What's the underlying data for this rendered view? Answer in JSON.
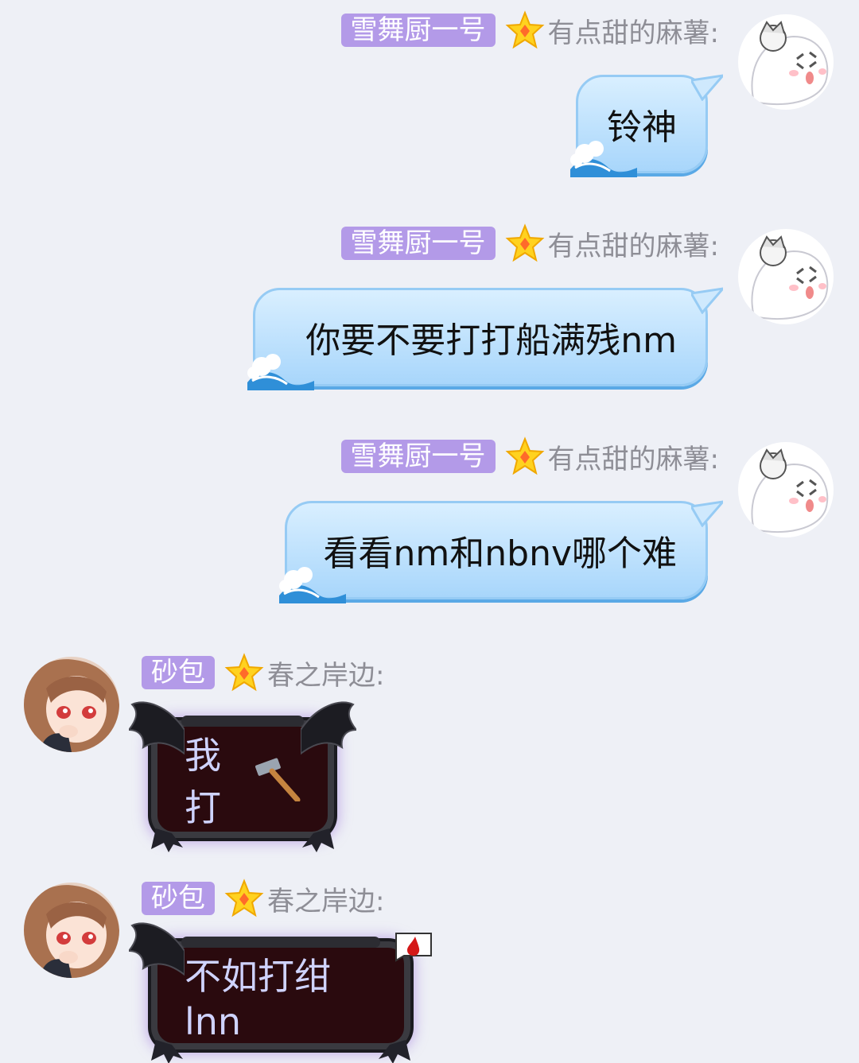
{
  "messages": [
    {
      "side": "right",
      "title_badge": "雪舞厨一号",
      "nickname": "有点甜的麻薯:",
      "text": "铃神"
    },
    {
      "side": "right",
      "title_badge": "雪舞厨一号",
      "nickname": "有点甜的麻薯:",
      "text": "你要不要打打船满残nm"
    },
    {
      "side": "right",
      "title_badge": "雪舞厨一号",
      "nickname": "有点甜的麻薯:",
      "text": "看看nm和nbnv哪个难"
    },
    {
      "side": "left",
      "title_badge": "砂包",
      "nickname": "春之岸边:",
      "text": "我打",
      "emoji": "hammer-icon"
    },
    {
      "side": "left",
      "title_badge": "砂包",
      "nickname": "春之岸边:",
      "text": "不如打绀lnn",
      "emoji": "blood-drop-icon"
    }
  ],
  "colors": {
    "background": "#eef0f6",
    "badge": "#b39ae8",
    "nickname": "#8e8e96",
    "bubble_blue": "#a8d6fb",
    "bubble_dark": "#2a0a0e"
  }
}
